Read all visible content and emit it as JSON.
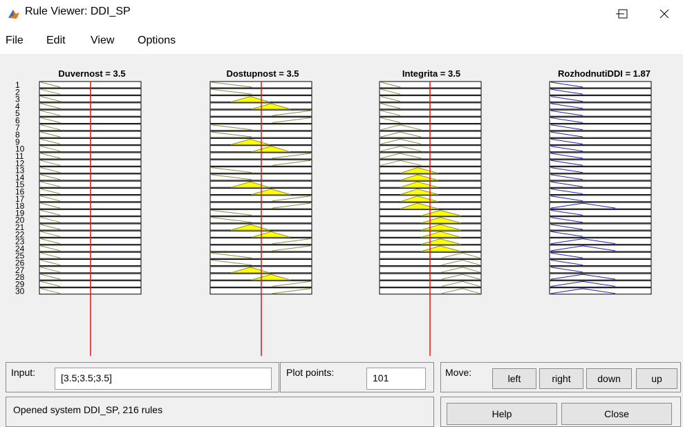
{
  "window": {
    "title": "Rule Viewer: DDI_SP",
    "controls": {
      "minimize": "—",
      "maximize": "☐",
      "close": "✕"
    }
  },
  "menu": [
    "File",
    "Edit",
    "View",
    "Options"
  ],
  "plot": {
    "headers": [
      "Duvernost = 3.5",
      "Dostupnost = 3.5",
      "Integrita = 3.5",
      "RozhodnutiDDI = 1.87"
    ],
    "rule_numbers": [
      "1",
      "2",
      "3",
      "4",
      "5",
      "6",
      "7",
      "8",
      "9",
      "10",
      "11",
      "12",
      "13",
      "14",
      "15",
      "16",
      "17",
      "18",
      "19",
      "20",
      "21",
      "22",
      "23",
      "24",
      "25",
      "26",
      "27",
      "28",
      "29",
      "30"
    ],
    "input_line_values": [
      3.5,
      3.5,
      3.5
    ],
    "colors": {
      "input_line": "#e8140a",
      "mf_line": "#8c8c3c",
      "fill": "#ffff00",
      "output_line": "#2020c8",
      "box_border": "#000000",
      "background": "#f0f0f0"
    }
  },
  "input_panel": {
    "label": "Input:",
    "value": "[3.5;3.5;3.5]",
    "plot_points_label": "Plot points:",
    "plot_points_value": "101"
  },
  "move_panel": {
    "label": "Move:",
    "buttons": [
      "left",
      "right",
      "down",
      "up"
    ]
  },
  "status": {
    "text": "Opened system DDI_SP, 216 rules"
  },
  "bottom_buttons": {
    "help": "Help",
    "close": "Close"
  }
}
